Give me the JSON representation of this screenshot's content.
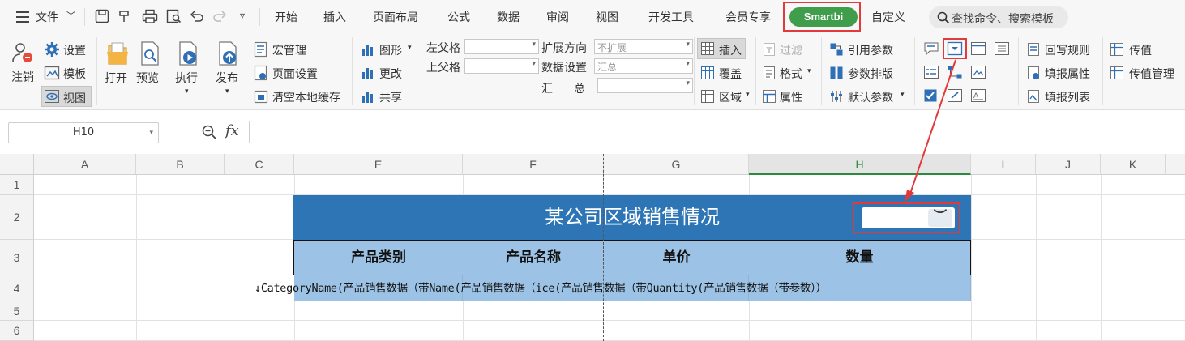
{
  "menubar": {
    "file_label": "文件",
    "tabs": [
      "开始",
      "插入",
      "页面布局",
      "公式",
      "数据",
      "审阅",
      "视图",
      "开发工具",
      "会员专享",
      "Smartbi",
      "自定义"
    ],
    "search_placeholder": "查找命令、搜索模板"
  },
  "ribbon": {
    "logout": "注销",
    "settings": "设置",
    "template": "模板",
    "view": "视图",
    "open": "打开",
    "preview": "预览",
    "execute": "执行",
    "publish": "发布",
    "macro": "宏管理",
    "page_setup": "页面设置",
    "clear_cache": "清空本地缓存",
    "chart": "图形",
    "update": "更改",
    "share": "共享",
    "left_parent": "左父格",
    "top_parent": "上父格",
    "expand_dir": "扩展方向",
    "expand_dir_value": "不扩展",
    "data_setting": "数据设置",
    "data_setting_value": "汇总",
    "summary_1": "汇",
    "summary_2": "总",
    "insert": "插入",
    "cover": "覆盖",
    "area": "区域",
    "filter": "过滤",
    "format": "格式",
    "attribute": "属性",
    "ref_param": "引用参数",
    "param_layout": "参数排版",
    "default_param": "默认参数",
    "writeback_rule": "回写规则",
    "fill_attr": "填报属性",
    "fill_list": "填报列表",
    "pass_value": "传值",
    "pass_value_mgr": "传值管理"
  },
  "formula": {
    "cell_ref": "H10",
    "fx": "fx"
  },
  "sheet": {
    "columns": [
      "A",
      "B",
      "C",
      "E",
      "F",
      "G",
      "H",
      "I",
      "J",
      "K"
    ],
    "rows": [
      "1",
      "2",
      "3",
      "4",
      "5",
      "6"
    ],
    "title": "某公司区域销售情况",
    "headers": [
      "产品类别",
      "产品名称",
      "单价",
      "数量"
    ],
    "data_row_text": "↓CategoryName(产品销售数据（带Name(产品销售数据（ice(产品销售数据（带Quantity(产品销售数据（带参数））"
  },
  "colors": {
    "smartbi_tab": "#3f9d4b",
    "highlight": "#e23a3a",
    "title_fill": "#2e75b6",
    "header_fill": "#9cc3e5",
    "active_column": "#2a8a3e"
  }
}
